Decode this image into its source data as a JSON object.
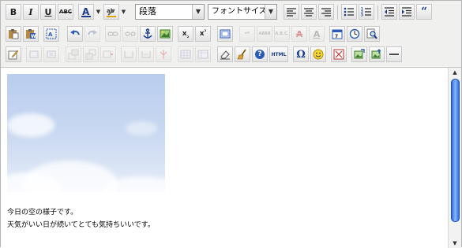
{
  "toolbar": {
    "format_select": {
      "value": "段落"
    },
    "fontsize_select": {
      "value": "フォントサイズ"
    },
    "bold_label": "B",
    "italic_label": "I",
    "underline_label": "U",
    "strike_label": "ABC",
    "sub_label": "x",
    "sup_label": "x",
    "html_label": "HTML",
    "omega_label": "Ω",
    "help_label": "?",
    "quote_label": "“"
  },
  "content": {
    "lines": [
      "今日の空の様子です。",
      "天気がいい日が続いてとても気持ちいいです。"
    ]
  },
  "colors": {
    "scrollbar_thumb": "#3f7fe8",
    "toolbar_bg": "#f0f0ee"
  }
}
